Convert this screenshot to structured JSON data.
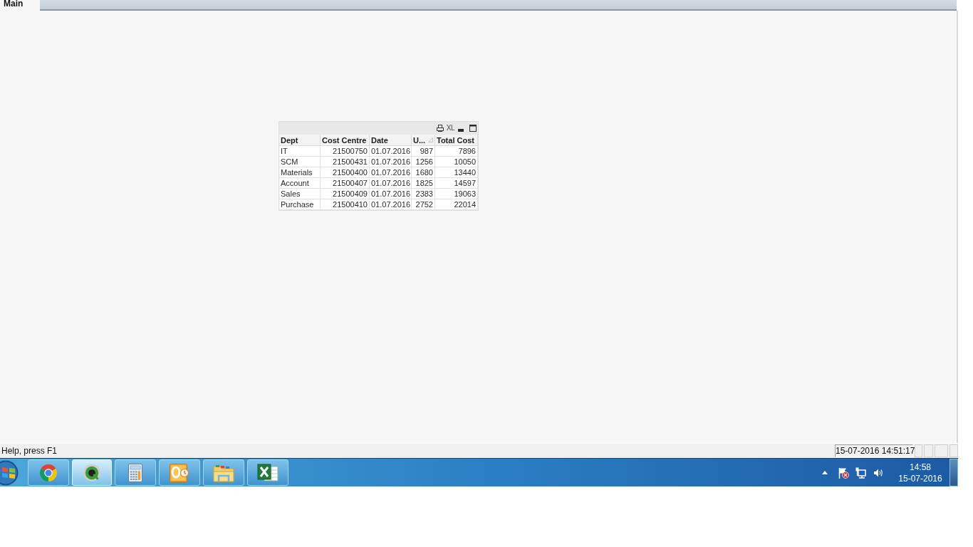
{
  "tabs": [
    {
      "label": "Main",
      "selected": true
    }
  ],
  "table_box": {
    "caption_buttons": [
      {
        "kind": "print"
      },
      {
        "kind": "xl",
        "label": "XL"
      },
      {
        "kind": "minimize"
      },
      {
        "kind": "maximize"
      }
    ],
    "columns": [
      {
        "label": "Dept",
        "kind": "text",
        "sorted": false
      },
      {
        "label": "Cost Centre",
        "kind": "number",
        "sorted": false
      },
      {
        "label": "Date",
        "kind": "text",
        "sorted": false
      },
      {
        "label": "U...",
        "kind": "number",
        "sorted": true
      },
      {
        "label": "Total Cost",
        "kind": "number",
        "sorted": false
      }
    ],
    "rows": [
      [
        "IT",
        "21500750",
        "01.07.2016",
        "987",
        "7896"
      ],
      [
        "SCM",
        "21500431",
        "01.07.2016",
        "1256",
        "10050"
      ],
      [
        "Materials",
        "21500400",
        "01.07.2016",
        "1680",
        "13440"
      ],
      [
        "Account",
        "21500407",
        "01.07.2016",
        "1825",
        "14597"
      ],
      [
        "Sales",
        "21500409",
        "01.07.2016",
        "2383",
        "19063"
      ],
      [
        "Purchase",
        "21500410",
        "01.07.2016",
        "2752",
        "22014"
      ]
    ]
  },
  "status_bar": {
    "help_text": "Help, press F1",
    "timestamp": "15-07-2016 14:51:17"
  },
  "taskbar": {
    "apps": [
      {
        "kind": "chrome",
        "selected": false
      },
      {
        "kind": "qlikview",
        "selected": true
      },
      {
        "kind": "calculator",
        "selected": false
      },
      {
        "kind": "outlook",
        "selected": false
      },
      {
        "kind": "folder",
        "selected": false
      },
      {
        "kind": "excel",
        "selected": false
      }
    ],
    "tray_icons": [
      {
        "kind": "show-hidden"
      },
      {
        "kind": "flag-alert"
      },
      {
        "kind": "network"
      },
      {
        "kind": "volume"
      }
    ],
    "clock": {
      "time": "14:58",
      "date": "15-07-2016"
    }
  }
}
